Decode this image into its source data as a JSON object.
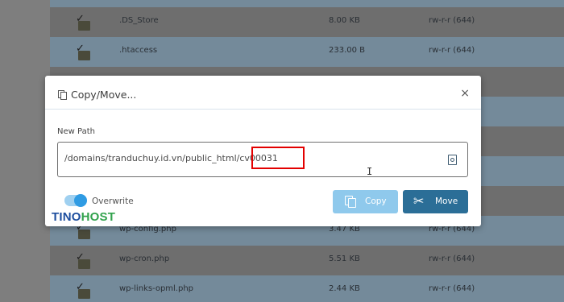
{
  "files": [
    {
      "name": ".DS_Store",
      "size": "8.00 KB",
      "perm": "rw-r-r (644)"
    },
    {
      "name": ".htaccess",
      "size": "233.00 B",
      "perm": "rw-r-r (644)"
    },
    {
      "name": "wp-config.php",
      "size": "3.47 KB",
      "perm": "rw-r-r (644)"
    },
    {
      "name": "wp-cron.php",
      "size": "5.51 KB",
      "perm": "rw-r-r (644)"
    },
    {
      "name": "wp-links-opml.php",
      "size": "2.44 KB",
      "perm": "rw-r-r (644)"
    }
  ],
  "modal": {
    "title": "Copy/Move...",
    "close": "×",
    "path_label": "New Path",
    "path_value": "/domains/tranduchuy.id.vn/public_html/cv00031",
    "overwrite_label": "Overwrite",
    "overwrite_on": true,
    "copy_label": "Copy",
    "move_label": "Move"
  },
  "logo": {
    "part1": "TINO",
    "part2": "HOST"
  },
  "colors": {
    "highlight": "#e30000",
    "move": "#2b6e97",
    "copy": "#8fc9ec",
    "toggle": "#2f9be3"
  }
}
